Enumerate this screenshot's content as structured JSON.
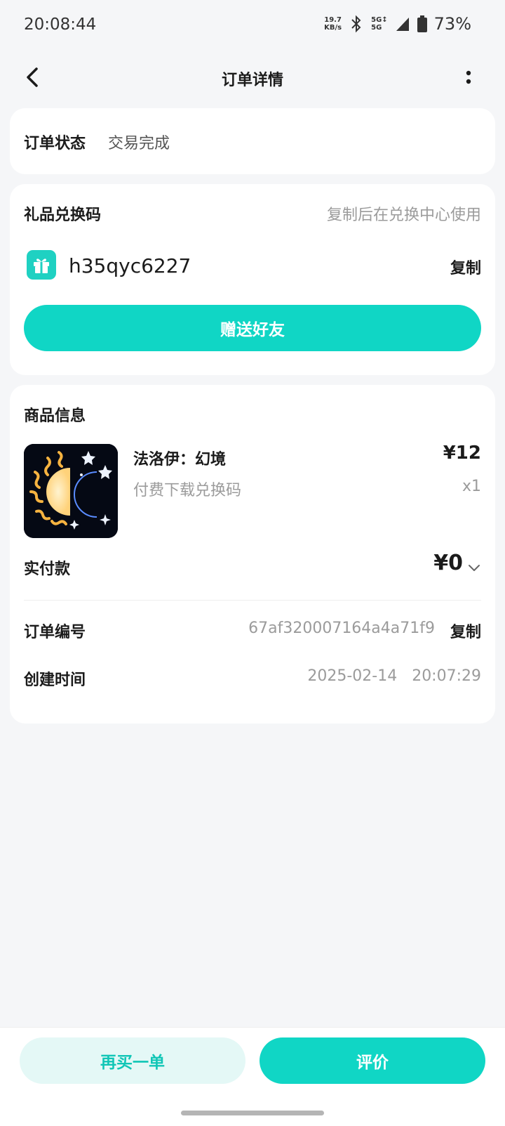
{
  "status_bar": {
    "time": "20:08:44",
    "net_speed_value": "19.7",
    "net_speed_unit": "KB/s",
    "network_top": "5G↕",
    "network_bottom": "5G",
    "battery": "73%",
    "icons": [
      "bluetooth-icon",
      "signal-icon",
      "battery-icon"
    ]
  },
  "nav": {
    "title": "订单详情",
    "back_icon": "chevron-left-icon",
    "more_icon": "more-vertical-icon"
  },
  "order_status": {
    "label": "订单状态",
    "value": "交易完成"
  },
  "gift_code": {
    "title": "礼品兑换码",
    "hint": "复制后在兑换中心使用",
    "icon": "gift-icon",
    "code": "h35qyc6227",
    "copy_label": "复制",
    "send_button": "赠送好友"
  },
  "product": {
    "section_title": "商品信息",
    "name": "法洛伊：幻境",
    "subtitle": "付费下载兑换码",
    "price": "¥12",
    "quantity": "x1",
    "image_icon": "sun-moon-game-icon"
  },
  "payment": {
    "label": "实付款",
    "amount": "¥0",
    "expand_icon": "chevron-down-icon"
  },
  "order_info": {
    "number_label": "订单编号",
    "number_value": "67af320007164a4a71f9",
    "number_copy": "复制",
    "time_label": "创建时间",
    "time_value": "2025-02-14 20:07:29"
  },
  "bottom": {
    "rebuy_button": "再买一单",
    "review_button": "评价"
  },
  "colors": {
    "accent": "#10d6c5",
    "accent_light": "#e4f8f6",
    "background": "#f5f6f8"
  }
}
